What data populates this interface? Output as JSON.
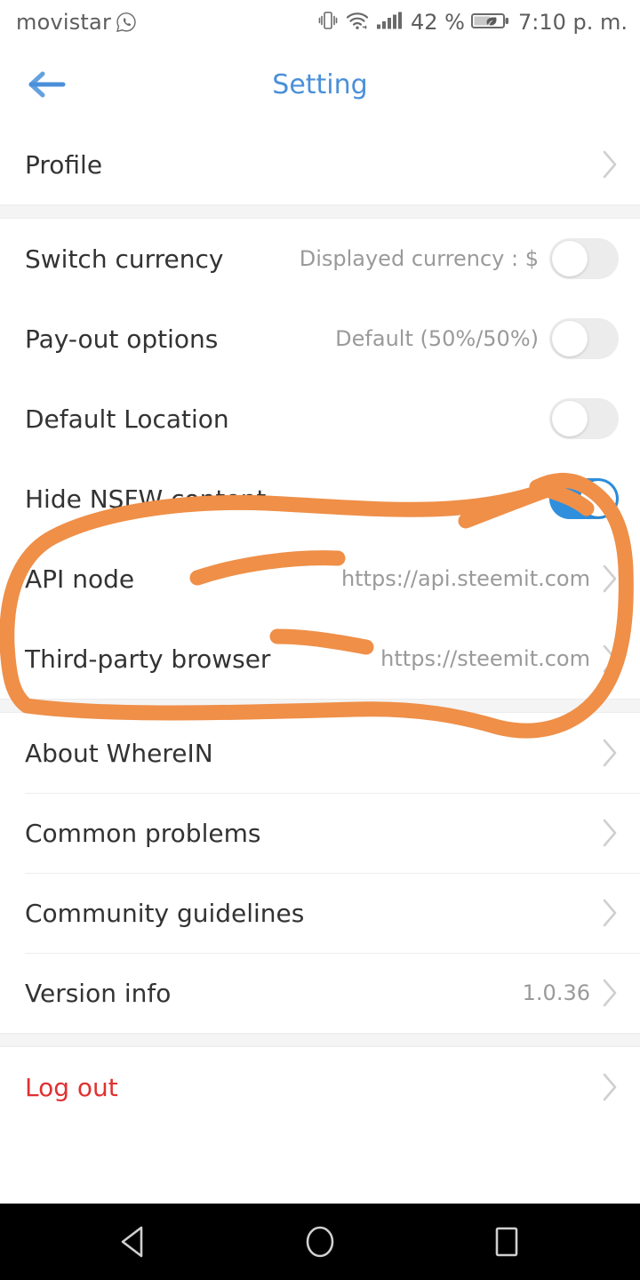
{
  "status_bar": {
    "carrier": "movistar",
    "whatsapp_icon": "whatsapp-icon",
    "vibrate_icon": "vibrate-icon",
    "wifi_icon": "wifi-icon",
    "signal_icon": "signal-bars-icon",
    "battery_percent": "42 %",
    "battery_icon": "battery-saver-leaf-icon",
    "time": "7:10 p. m."
  },
  "header": {
    "back_icon": "back-arrow-icon",
    "title": "Setting",
    "title_color": "#4a90d9"
  },
  "groups": [
    {
      "rows": [
        {
          "label": "Profile",
          "value": "",
          "control": "chevron"
        }
      ]
    },
    {
      "rows": [
        {
          "label": "Switch currency",
          "value": "Displayed currency :  $",
          "control": "toggle",
          "toggle_on": false
        },
        {
          "label": "Pay-out options",
          "value": "Default (50%/50%)",
          "control": "toggle",
          "toggle_on": false
        },
        {
          "label": "Default Location",
          "value": "",
          "control": "toggle",
          "toggle_on": false
        },
        {
          "label": "Hide NSFW content",
          "value": "",
          "control": "toggle",
          "toggle_on": true
        },
        {
          "label": "API node",
          "value": "https://api.steemit.com",
          "control": "chevron"
        },
        {
          "label": "Third-party browser",
          "value": "https://steemit.com",
          "control": "chevron"
        }
      ]
    },
    {
      "rows": [
        {
          "label": "About WhereIN",
          "value": "",
          "control": "chevron"
        },
        {
          "label": "Common problems",
          "value": "",
          "control": "chevron"
        },
        {
          "label": "Community guidelines",
          "value": "",
          "control": "chevron"
        },
        {
          "label": "Version info",
          "value": "1.0.36",
          "control": "chevron"
        }
      ]
    },
    {
      "rows": [
        {
          "label": "Log out",
          "value": "",
          "control": "chevron",
          "danger": true
        }
      ]
    }
  ],
  "annotation": {
    "type": "handdrawn-orange-circle-highlight",
    "color": "#ef8f48",
    "targets": [
      "Hide NSFW content toggle",
      "API node",
      "Third-party browser"
    ]
  },
  "nav_bar": {
    "back_icon": "nav-back-triangle-icon",
    "home_icon": "nav-home-circle-icon",
    "recents_icon": "nav-recents-square-icon",
    "background": "#000000"
  },
  "colors": {
    "accent_blue": "#2f8fdd",
    "title_blue": "#4a90d9",
    "danger_red": "#e03131",
    "value_gray": "#9a9a9a",
    "label_dark": "#333333",
    "annotation_orange": "#ef8f48"
  }
}
